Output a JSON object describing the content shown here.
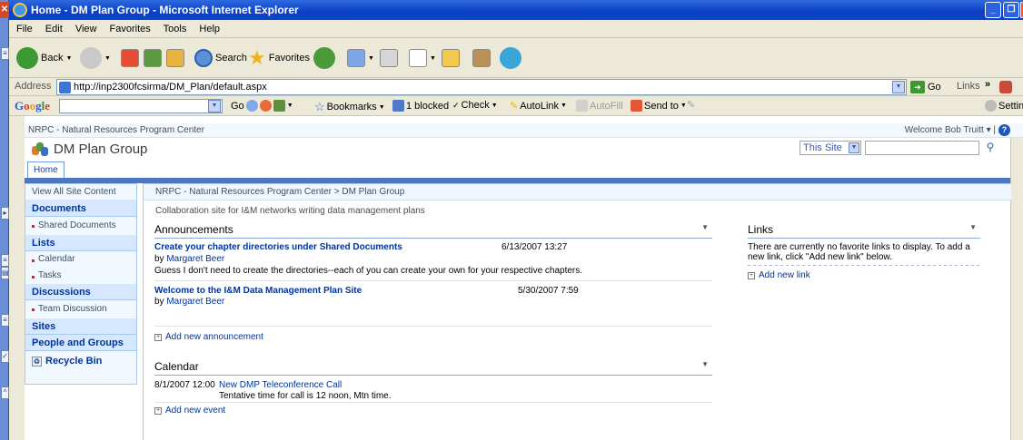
{
  "window": {
    "title": "Home - DM Plan Group - Microsoft Internet Explorer"
  },
  "menu": [
    "File",
    "Edit",
    "View",
    "Favorites",
    "Tools",
    "Help"
  ],
  "toolbar": {
    "back_label": "Back",
    "search_label": "Search",
    "favorites_label": "Favorites"
  },
  "address": {
    "label": "Address",
    "url": "http://inp2300fcsirma/DM_Plan/default.aspx",
    "go_label": "Go",
    "links_label": "Links"
  },
  "googlebar": {
    "logo": "Google",
    "go_label": "Go",
    "bookmarks_label": "Bookmarks",
    "blocked_label": "1 blocked",
    "check_label": "Check",
    "autolink_label": "AutoLink",
    "autofill_label": "AutoFill",
    "sendto_label": "Send to",
    "settings_label": "Settings"
  },
  "sp": {
    "top_site": "NRPC - Natural Resources Program Center",
    "welcome": "Welcome Bob Truitt",
    "site_title": "DM Plan Group",
    "search_scope": "This Site",
    "home_tab": "Home",
    "breadcrumb": "NRPC - Natural Resources Program Center > DM Plan Group",
    "description": "Collaboration site for I&M networks writing data management plans"
  },
  "quicklaunch": {
    "view_all": "View All Site Content",
    "documents": "Documents",
    "shared_documents": "Shared Documents",
    "lists": "Lists",
    "calendar": "Calendar",
    "tasks": "Tasks",
    "discussions": "Discussions",
    "team_discussion": "Team Discussion",
    "sites": "Sites",
    "people_groups": "People and Groups",
    "recycle_bin": "Recycle Bin"
  },
  "announcements": {
    "title": "Announcements",
    "items": [
      {
        "title": "Create your chapter directories under Shared Documents",
        "date": "6/13/2007 13:27",
        "by_prefix": "by",
        "author": "Margaret Beer",
        "body": "Guess I don't need to create the directories--each of you can create your own for your respective chapters."
      },
      {
        "title": "Welcome to the I&M Data Management Plan Site",
        "date": "5/30/2007 7:59",
        "by_prefix": "by",
        "author": "Margaret Beer",
        "body": ""
      }
    ],
    "add_label": "Add new announcement"
  },
  "calendar": {
    "title": "Calendar",
    "events": [
      {
        "date": "8/1/2007 12:00",
        "title": "New DMP Teleconference Call",
        "desc": "Tentative time for call is 12 noon, Mtn time."
      }
    ],
    "add_label": "Add new event"
  },
  "links": {
    "title": "Links",
    "message": "There are currently no favorite links to display. To add a new link, click \"Add new link\" below.",
    "add_label": "Add new link"
  }
}
